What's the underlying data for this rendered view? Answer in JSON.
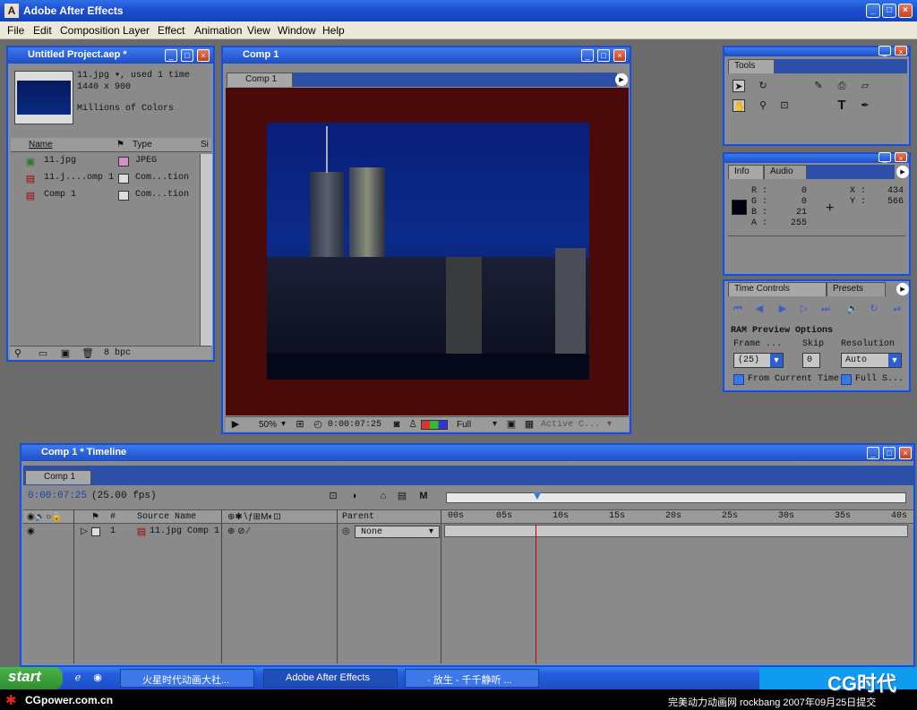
{
  "app": {
    "title": "Adobe After Effects"
  },
  "menu": [
    "File",
    "Edit",
    "Composition",
    "Layer",
    "Effect",
    "Animation",
    "View",
    "Window",
    "Help"
  ],
  "project": {
    "title": "Untitled Project.aep *",
    "selected_item": "11.jpg ▾, used 1 time",
    "dimensions": "1440 x 900",
    "colors": "Millions of Colors",
    "headers": {
      "name": "Name",
      "type": "Type",
      "size": "Si"
    },
    "items": [
      {
        "name": "11.jpg",
        "type": "JPEG"
      },
      {
        "name": "11.j....omp 1",
        "type": "Com...tion"
      },
      {
        "name": "Comp 1",
        "type": "Com...tion"
      }
    ],
    "bpc": "8 bpc"
  },
  "comp": {
    "title": "Comp 1",
    "tab": "Comp 1",
    "zoom": "50%",
    "time": "0:00:07:25",
    "resolution": "Full",
    "camera": "Active C..."
  },
  "tools": {
    "title": "Tools"
  },
  "info": {
    "tabs": [
      "Info",
      "Audio"
    ],
    "r_label": "R :",
    "r": "0",
    "g_label": "G :",
    "g": "0",
    "b_label": "B :",
    "b": "21",
    "a_label": "A :",
    "a": "255",
    "x_label": "X :",
    "x": "434",
    "y_label": "Y :",
    "y": "566",
    "swatch_color": "#000015"
  },
  "time_controls": {
    "tabs": [
      "Time Controls",
      "Presets"
    ],
    "ram_preview": "RAM Preview Options",
    "frame_label": "Frame ...",
    "skip_label": "Skip",
    "resolution_label": "Resolution",
    "frame_value": "(25)",
    "skip_value": "0",
    "resolution_value": "Auto",
    "from_current": "From Current Time",
    "full_screen": "Full S..."
  },
  "timeline": {
    "title": "Comp 1 * Timeline",
    "tab": "Comp 1",
    "current_time": "0:00:07:25",
    "fps": "(25.00 fps)",
    "col_num": "#",
    "col_source": "Source Name",
    "col_parent": "Parent",
    "layer_num": "1",
    "layer_name": "11.jpg Comp 1",
    "parent_value": "None",
    "ruler": [
      "00s",
      "05s",
      "10s",
      "15s",
      "20s",
      "25s",
      "30s",
      "35s",
      "40s"
    ],
    "playhead_seconds": 7.96
  },
  "taskbar": {
    "start": "start",
    "tasks": [
      "火星时代动画大社...",
      "Adobe After Effects",
      "· 放生 - 千千静听 ..."
    ]
  },
  "footer": {
    "left": "CGpower.com.cn",
    "right": "完美动力动画网 rockbang 2007年09月25日提交",
    "logo": "CG时代"
  },
  "colors": {
    "accent": "#1c4fd0",
    "panel": "#8a8a8a",
    "comp_bg": "#4a0a0a",
    "playhead": "#cc0000"
  }
}
